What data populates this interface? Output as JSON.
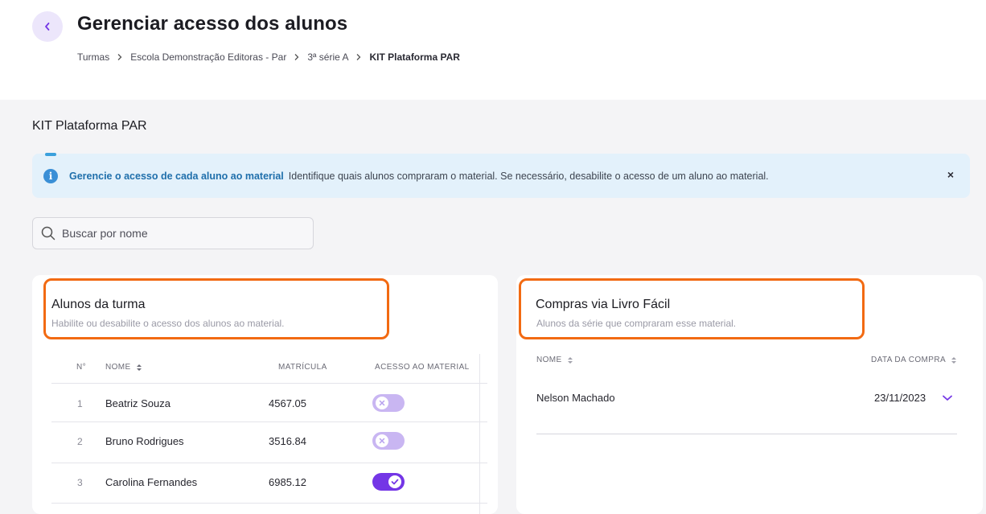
{
  "header": {
    "title": "Gerenciar acesso dos alunos",
    "breadcrumb": [
      "Turmas",
      "Escola Demonstração Editoras - Par",
      "3ª série A",
      "KIT Plataforma PAR"
    ]
  },
  "section": {
    "title": "KIT Plataforma PAR"
  },
  "banner": {
    "strong": "Gerencie o acesso de cada aluno ao material",
    "text": "Identifique quais alunos compraram o material. Se necessário, desabilite o acesso de um aluno ao material.",
    "close": "×"
  },
  "search": {
    "placeholder": "Buscar por nome",
    "value": ""
  },
  "students_card": {
    "title": "Alunos da turma",
    "subtitle": "Habilite ou desabilite o acesso dos alunos ao material.",
    "columns": {
      "number": "N°",
      "name": "NOME",
      "enrollment": "MATRÍCULA",
      "access": "ACESSO AO MATERIAL"
    },
    "rows": [
      {
        "number": "1",
        "name": "Beatriz Souza",
        "enrollment": "4567.05",
        "access": false
      },
      {
        "number": "2",
        "name": "Bruno Rodrigues",
        "enrollment": "3516.84",
        "access": false
      },
      {
        "number": "3",
        "name": "Carolina Fernandes",
        "enrollment": "6985.12",
        "access": true
      }
    ]
  },
  "purchases_card": {
    "title": "Compras via Livro Fácil",
    "subtitle": "Alunos da série que compraram esse material.",
    "columns": {
      "name": "NOME",
      "date": "DATA DA COMPRA"
    },
    "rows": [
      {
        "name": "Nelson Machado",
        "date": "23/11/2023"
      }
    ]
  },
  "colors": {
    "accent": "#7436e6",
    "accent_light": "#c9b6f2",
    "highlight": "#f26a12",
    "info": "#3a8fd6",
    "info_bg": "#e3f1fb"
  }
}
